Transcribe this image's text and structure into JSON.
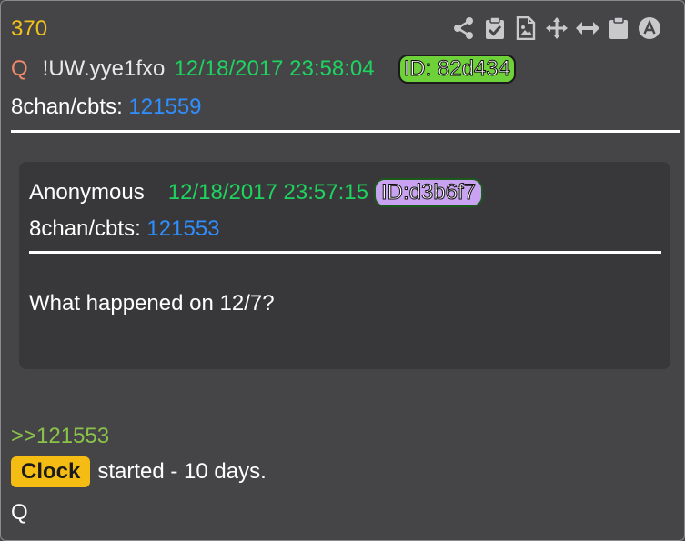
{
  "post": {
    "number": "370",
    "author": "Q",
    "tripcode": "!UW.yye1fxo",
    "timestamp": "12/18/2017 23:58:04",
    "id_badge": "ID: 82d434",
    "board_label": "8chan/cbts:",
    "board_post_link": "121559"
  },
  "toolbar": {
    "icons": [
      "share-icon",
      "clipboard-check-icon",
      "image-file-icon",
      "move-icon",
      "horizontal-arrows-icon",
      "clipboard-icon",
      "a-circle-icon"
    ]
  },
  "quoted_post": {
    "author": "Anonymous",
    "timestamp": "12/18/2017 23:57:15",
    "id_badge": "ID:d3b6f7",
    "board_label": "8chan/cbts:",
    "board_post_link": "121553",
    "text": "What happened on 12/7?"
  },
  "reply": {
    "reference": ">>121553",
    "highlight_word": "Clock",
    "text": "started - 10 days.",
    "signature": "Q"
  },
  "colors": {
    "background": "#454548",
    "quote_background": "#38383a",
    "post_number": "#f2c21b",
    "timestamp": "#1ed35f",
    "link": "#2f8fff",
    "reply_ref": "#8bc34a",
    "id_badge_main": "#6fd13a",
    "id_badge_quote": "#c9a2f1",
    "highlight": "#f5bd14"
  }
}
